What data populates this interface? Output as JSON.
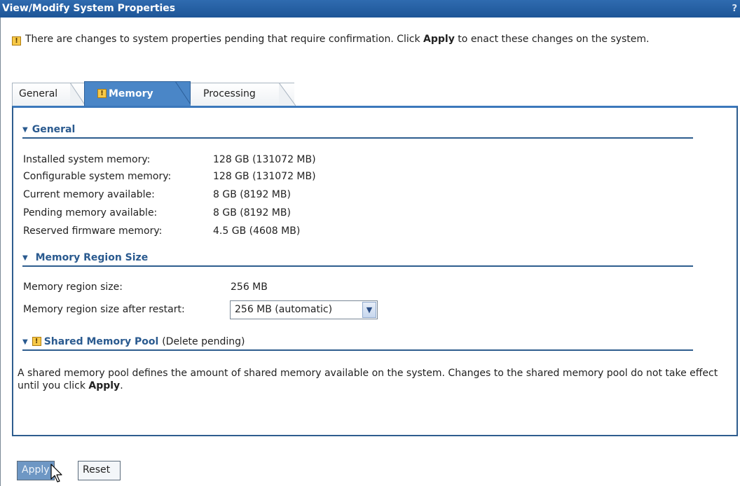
{
  "window": {
    "title": "View/Modify System Properties",
    "help_glyph": "?"
  },
  "notice": {
    "text_before": "There are changes to system properties pending that require confirmation. Click ",
    "bold": "Apply",
    "text_after": " to enact these changes on the system."
  },
  "tabs": [
    {
      "label": "General",
      "active": false
    },
    {
      "label": "Memory",
      "active": true,
      "warning": true
    },
    {
      "label": "Processing",
      "active": false
    }
  ],
  "sections": {
    "general": {
      "title": "General",
      "rows": [
        {
          "label": "Installed system memory:",
          "value": "128 GB (131072 MB)"
        },
        {
          "label": "Configurable system memory:",
          "value": "128 GB (131072 MB)"
        },
        {
          "label": "Current memory available:",
          "value": "8 GB (8192 MB)"
        },
        {
          "label": "Pending memory available:",
          "value": "8 GB (8192 MB)"
        },
        {
          "label": "Reserved firmware memory:",
          "value": "4.5 GB (4608 MB)"
        }
      ]
    },
    "region": {
      "title": "Memory Region Size",
      "size_label": "Memory region size:",
      "size_value": "256 MB",
      "restart_label": "Memory region size after restart:",
      "restart_selected": "256 MB (automatic)"
    },
    "shared": {
      "title": "Shared Memory Pool",
      "status": "(Delete pending)",
      "desc_before": "A shared memory pool defines the amount of shared memory available on the system. Changes to the shared memory pool do not take effect until you click ",
      "desc_bold": "Apply",
      "desc_after": "."
    }
  },
  "buttons": {
    "apply": "Apply",
    "reset": "Reset"
  },
  "colors": {
    "accent": "#1d5597",
    "tab_active": "#4a86c7",
    "warning": "#f7c948"
  }
}
